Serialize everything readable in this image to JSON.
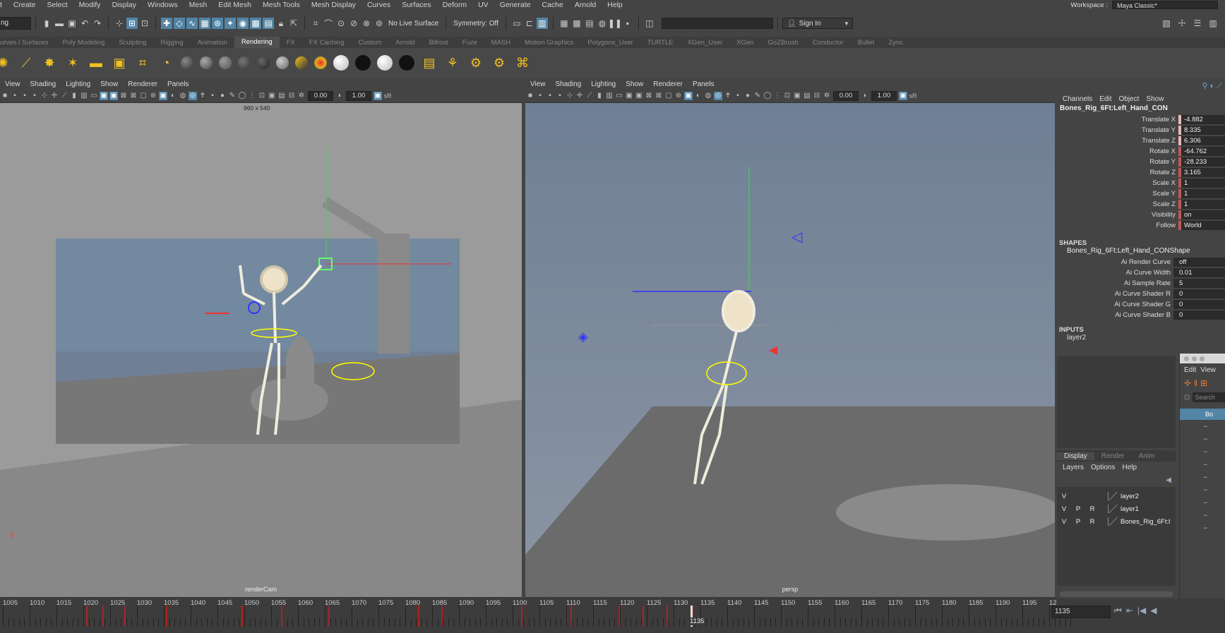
{
  "menubar": {
    "items": [
      "t",
      "Create",
      "Select",
      "Modify",
      "Display",
      "Windows",
      "Mesh",
      "Edit Mesh",
      "Mesh Tools",
      "Mesh Display",
      "Curves",
      "Surfaces",
      "Deform",
      "UV",
      "Generate",
      "Cache",
      "Arnold",
      "Help"
    ],
    "workspace_label": "Workspace :",
    "workspace_value": "Maya Classic*"
  },
  "statusline": {
    "mode": "ng",
    "live_surface": "No Live Surface",
    "symmetry": "Symmetry: Off",
    "sign_in": "Sign In"
  },
  "shelf_tabs": {
    "items": [
      "urves / Surfaces",
      "Poly Modeling",
      "Sculpting",
      "Rigging",
      "Animation",
      "Rendering",
      "FX",
      "FX Caching",
      "Custom",
      "Arnold",
      "Bifrost",
      "Fuze",
      "MASH",
      "Motion Graphics",
      "Polygons_User",
      "TURTLE",
      "XGen_User",
      "XGen",
      "GoZBrush",
      "Conductor",
      "Bullet",
      "Zync"
    ],
    "active": "Rendering"
  },
  "left_viewport": {
    "menu": [
      "View",
      "Shading",
      "Lighting",
      "Show",
      "Renderer",
      "Panels"
    ],
    "field1": "0.00",
    "field2": "1.00",
    "resolution": "960 x 540",
    "camera": "renderCam"
  },
  "right_viewport": {
    "menu": [
      "View",
      "Shading",
      "Lighting",
      "Show",
      "Renderer",
      "Panels"
    ],
    "field1": "0.00",
    "field2": "1.00",
    "camera": "persp"
  },
  "channel_box": {
    "menu": [
      "Channels",
      "Edit",
      "Object",
      "Show"
    ],
    "object_name": "Bones_Rig_6Ft:Left_Hand_CON",
    "channels": [
      {
        "label": "Translate X",
        "value": "-4.882",
        "state": "pink"
      },
      {
        "label": "Translate Y",
        "value": "8.335",
        "state": "pink"
      },
      {
        "label": "Translate Z",
        "value": "6.306",
        "state": "pink"
      },
      {
        "label": "Rotate X",
        "value": "-64.762",
        "state": "key"
      },
      {
        "label": "Rotate Y",
        "value": "-28.233",
        "state": "key"
      },
      {
        "label": "Rotate Z",
        "value": "3.165",
        "state": "key"
      },
      {
        "label": "Scale X",
        "value": "1",
        "state": "key"
      },
      {
        "label": "Scale Y",
        "value": "1",
        "state": "key"
      },
      {
        "label": "Scale Z",
        "value": "1",
        "state": "key"
      },
      {
        "label": "Visibility",
        "value": "on",
        "state": "key"
      },
      {
        "label": "Follow",
        "value": "World",
        "state": "key"
      }
    ],
    "shapes_title": "SHAPES",
    "shape_name": "Bones_Rig_6Ft:Left_Hand_CONShape",
    "shape_attrs": [
      {
        "label": "Ai Render Curve",
        "value": "off"
      },
      {
        "label": "Ai Curve Width",
        "value": "0.01"
      },
      {
        "label": "Ai Sample Rate",
        "value": "5"
      },
      {
        "label": "Ai Curve Shader R",
        "value": "0"
      },
      {
        "label": "Ai Curve Shader G",
        "value": "0"
      },
      {
        "label": "Ai Curve Shader B",
        "value": "0"
      }
    ],
    "inputs_title": "INPUTS",
    "input_name": "layer2"
  },
  "layer_editor": {
    "tabs": [
      "Display",
      "Render",
      "Anim"
    ],
    "menu": [
      "Layers",
      "Options",
      "Help"
    ],
    "layers": [
      {
        "v": "V",
        "p": "",
        "r": "",
        "name": "layer2"
      },
      {
        "v": "V",
        "p": "P",
        "r": "R",
        "name": "layer1"
      },
      {
        "v": "V",
        "p": "P",
        "r": "R",
        "name": "Bones_Rig_6Ft:l"
      }
    ]
  },
  "outliner": {
    "menu": [
      "Edit",
      "View"
    ],
    "search": "Search",
    "selected_item": "Bo"
  },
  "timeline": {
    "labels": [
      "1005",
      "1010",
      "1015",
      "1020",
      "1025",
      "1030",
      "1035",
      "1040",
      "1045",
      "1050",
      "1055",
      "1060",
      "1065",
      "1070",
      "1075",
      "1080",
      "1085",
      "1090",
      "1095",
      "1100",
      "1105",
      "1110",
      "1115",
      "1120",
      "1125",
      "1130",
      "1135",
      "1140",
      "1145",
      "1150",
      "1155",
      "1160",
      "1165",
      "1170",
      "1175",
      "1180",
      "1185",
      "1190",
      "1195",
      "12"
    ],
    "current_marker": "1135",
    "current_frame": "1135"
  }
}
